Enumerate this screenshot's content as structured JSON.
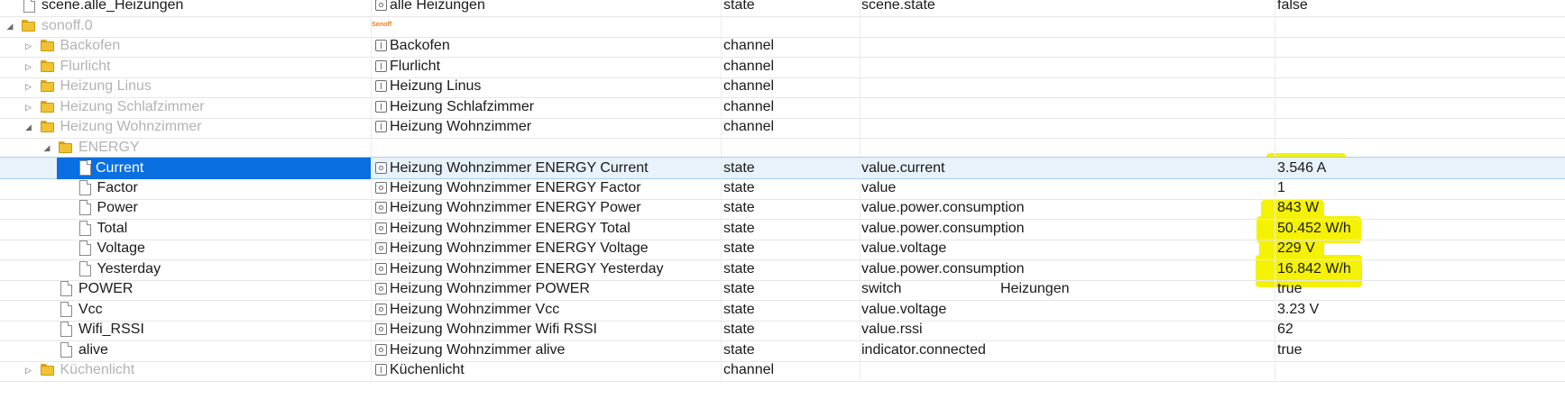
{
  "rows": [
    {
      "name": "scene.alle_Heizungen",
      "title": "alle Heizungen",
      "type": "state",
      "role": "scene.state",
      "room": "",
      "value": "false",
      "kind": "file",
      "ricon": "state",
      "indent": 0,
      "arrow": "",
      "muted": false,
      "selected": false
    },
    {
      "name": "sonoff.0",
      "title": "",
      "type": "",
      "role": "",
      "room": "",
      "value": "",
      "kind": "folder",
      "ricon": "logo",
      "indent": 0,
      "arrow": "collapse",
      "muted": true,
      "selected": false
    },
    {
      "name": "Backofen",
      "title": "Backofen",
      "type": "channel",
      "role": "",
      "room": "",
      "value": "",
      "kind": "folder",
      "ricon": "channel",
      "indent": 1,
      "arrow": "expand",
      "muted": true,
      "selected": false
    },
    {
      "name": "Flurlicht",
      "title": "Flurlicht",
      "type": "channel",
      "role": "",
      "room": "",
      "value": "",
      "kind": "folder",
      "ricon": "channel",
      "indent": 1,
      "arrow": "expand",
      "muted": true,
      "selected": false
    },
    {
      "name": "Heizung Linus",
      "title": "Heizung Linus",
      "type": "channel",
      "role": "",
      "room": "",
      "value": "",
      "kind": "folder",
      "ricon": "channel",
      "indent": 1,
      "arrow": "expand",
      "muted": true,
      "selected": false
    },
    {
      "name": "Heizung Schlafzimmer",
      "title": "Heizung Schlafzimmer",
      "type": "channel",
      "role": "",
      "room": "",
      "value": "",
      "kind": "folder",
      "ricon": "channel",
      "indent": 1,
      "arrow": "expand",
      "muted": true,
      "selected": false
    },
    {
      "name": "Heizung Wohnzimmer",
      "title": "Heizung Wohnzimmer",
      "type": "channel",
      "role": "",
      "room": "",
      "value": "",
      "kind": "folder",
      "ricon": "channel",
      "indent": 1,
      "arrow": "collapse",
      "muted": true,
      "selected": false
    },
    {
      "name": "ENERGY",
      "title": "",
      "type": "",
      "role": "",
      "room": "",
      "value": "",
      "kind": "folder",
      "ricon": "",
      "indent": 2,
      "arrow": "collapse",
      "muted": true,
      "selected": false
    },
    {
      "name": "Current",
      "title": "Heizung Wohnzimmer ENERGY Current",
      "type": "state",
      "role": "value.current",
      "room": "",
      "value": "3.546 A",
      "kind": "file",
      "ricon": "state",
      "indent": 3,
      "arrow": "",
      "muted": false,
      "selected": true
    },
    {
      "name": "Factor",
      "title": "Heizung Wohnzimmer ENERGY Factor",
      "type": "state",
      "role": "value",
      "room": "",
      "value": "1",
      "kind": "file",
      "ricon": "state",
      "indent": 3,
      "arrow": "",
      "muted": false,
      "selected": false
    },
    {
      "name": "Power",
      "title": "Heizung Wohnzimmer ENERGY Power",
      "type": "state",
      "role": "value.power.consumption",
      "room": "",
      "value": "843 W",
      "kind": "file",
      "ricon": "state",
      "indent": 3,
      "arrow": "",
      "muted": false,
      "selected": false
    },
    {
      "name": "Total",
      "title": "Heizung Wohnzimmer ENERGY Total",
      "type": "state",
      "role": "value.power.consumption",
      "room": "",
      "value": "50.452 W/h",
      "kind": "file",
      "ricon": "state",
      "indent": 3,
      "arrow": "",
      "muted": false,
      "selected": false
    },
    {
      "name": "Voltage",
      "title": "Heizung Wohnzimmer ENERGY Voltage",
      "type": "state",
      "role": "value.voltage",
      "room": "",
      "value": "229 V",
      "kind": "file",
      "ricon": "state",
      "indent": 3,
      "arrow": "",
      "muted": false,
      "selected": false
    },
    {
      "name": "Yesterday",
      "title": "Heizung Wohnzimmer ENERGY Yesterday",
      "type": "state",
      "role": "value.power.consumption",
      "room": "",
      "value": "16.842 W/h",
      "kind": "file",
      "ricon": "state",
      "indent": 3,
      "arrow": "",
      "muted": false,
      "selected": false
    },
    {
      "name": "POWER",
      "title": "Heizung Wohnzimmer POWER",
      "type": "state",
      "role": "switch",
      "room": "Heizungen",
      "value": "true",
      "kind": "file",
      "ricon": "state",
      "indent": 2,
      "arrow": "",
      "muted": false,
      "selected": false
    },
    {
      "name": "Vcc",
      "title": "Heizung Wohnzimmer Vcc",
      "type": "state",
      "role": "value.voltage",
      "room": "",
      "value": "3.23 V",
      "kind": "file",
      "ricon": "state",
      "indent": 2,
      "arrow": "",
      "muted": false,
      "selected": false
    },
    {
      "name": "Wifi_RSSI",
      "title": "Heizung Wohnzimmer Wifi RSSI",
      "type": "state",
      "role": "value.rssi",
      "room": "",
      "value": "62",
      "kind": "file",
      "ricon": "state",
      "indent": 2,
      "arrow": "",
      "muted": false,
      "selected": false
    },
    {
      "name": "alive",
      "title": "Heizung Wohnzimmer alive",
      "type": "state",
      "role": "indicator.connected",
      "room": "",
      "value": "true",
      "kind": "file",
      "ricon": "state",
      "indent": 2,
      "arrow": "",
      "muted": false,
      "selected": false
    },
    {
      "name": "Küchenlicht",
      "title": "Küchenlicht",
      "type": "channel",
      "role": "",
      "room": "",
      "value": "",
      "kind": "folder",
      "ricon": "channel",
      "indent": 1,
      "arrow": "expand",
      "muted": true,
      "selected": false
    }
  ],
  "logo_text": "Sonoff",
  "colors": {
    "selection": "#0a6fe0",
    "highlight": "#f4f200",
    "folder": "#f1c232",
    "muted_text": "#b3b3b3"
  }
}
